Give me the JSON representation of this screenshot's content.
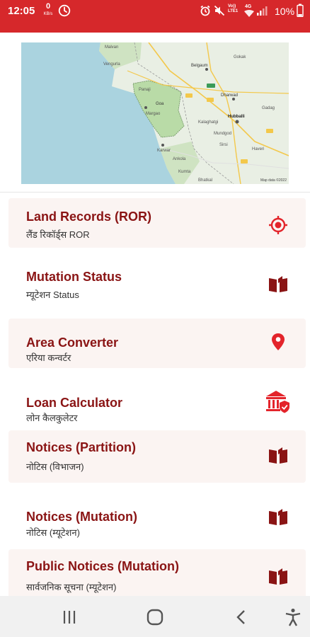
{
  "status_bar": {
    "time": "12:05",
    "net_speed": "0",
    "net_unit": "KB/s",
    "volte_line1": "Vo))",
    "volte_line2": "LTE1",
    "network": "4G",
    "battery": "10%",
    "icons": [
      "clock-icon",
      "alarm-icon",
      "mute-icon",
      "wifi-icon",
      "signal-icon",
      "battery-icon"
    ]
  },
  "map": {
    "labels": [
      "Malvan",
      "Vengurla",
      "Belgaum",
      "Gokak",
      "Dharwad",
      "Hubballi",
      "Goa",
      "Karwar",
      "Kumta",
      "Haveri",
      "Bhatkal",
      "Gadag",
      "Sirsi",
      "Panaji",
      "Kalaghatgi",
      "Ankola",
      "Margao",
      "Mundgod"
    ],
    "copyright": "Map data ©2022",
    "colors": {
      "land": "#e9efe4",
      "sea": "#aad3df",
      "goa": "#b9dba7",
      "road": "#f3c84b"
    }
  },
  "items": [
    {
      "title": "Land Records (ROR)",
      "subtitle": "लैंड रिकॉर्ड्स ROR",
      "icon": "target-icon"
    },
    {
      "title": "Mutation Status",
      "subtitle": "म्यूटेशन Status",
      "icon": "open-book-icon"
    },
    {
      "title": "Area Converter",
      "subtitle": "एरिया कन्वर्टर",
      "icon": "location-pin-icon"
    },
    {
      "title": "Loan Calculator",
      "subtitle": "लोन कैलकुलेटर",
      "icon": "bank-shield-icon"
    },
    {
      "title": "Notices (Partition)",
      "subtitle": "नोटिस (विभाजन)",
      "icon": "open-book-icon"
    },
    {
      "title": "Notices (Mutation)",
      "subtitle": "नोटिस (म्यूटेशन)",
      "icon": "open-book-icon"
    },
    {
      "title": "Public Notices (Mutation)",
      "subtitle": "सार्वजनिक सूचना (म्यूटेशन)",
      "icon": "open-book-icon"
    }
  ],
  "nav": [
    "recent-apps-icon",
    "home-icon",
    "back-icon",
    "accessibility-icon"
  ],
  "colors": {
    "status_bar": "#d6282b",
    "title": "#8a1414",
    "icon": "#e3242b",
    "row_shade": "#fbf4f2"
  }
}
